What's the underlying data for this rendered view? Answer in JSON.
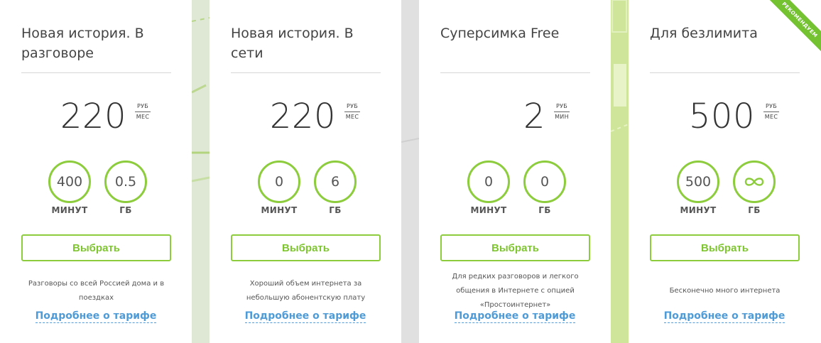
{
  "accent_color": "#8ccc3d",
  "link_color": "#4e9bd7",
  "tariffs": [
    {
      "title": "Новая история. В разговоре",
      "price": "220",
      "unit_top": "РУБ",
      "unit_bottom": "МЕС",
      "minutes": "400",
      "minutes_label": "МИНУТ",
      "gb": "0.5",
      "gb_label": "ГБ",
      "button": "Выбрать",
      "description": "Разговоры со всей Россией дома и в поездках",
      "link": "Подробнее о тарифе"
    },
    {
      "title": "Новая история. В сети",
      "price": "220",
      "unit_top": "РУБ",
      "unit_bottom": "МЕС",
      "minutes": "0",
      "minutes_label": "МИНУТ",
      "gb": "6",
      "gb_label": "ГБ",
      "button": "Выбрать",
      "description": "Хороший объем интернета за небольшую абонентскую плату",
      "link": "Подробнее о тарифе"
    },
    {
      "title": "Суперсимка Free",
      "price": "2",
      "unit_top": "РУБ",
      "unit_bottom": "МИН",
      "minutes": "0",
      "minutes_label": "МИНУТ",
      "gb": "0",
      "gb_label": "ГБ",
      "button": "Выбрать",
      "description": "Для редких разговоров и легкого общения в Интернете с опцией «Простоинтернет»",
      "link": "Подробнее о тарифе"
    },
    {
      "title": "Для безлимита",
      "price": "500",
      "unit_top": "РУБ",
      "unit_bottom": "МЕС",
      "minutes": "500",
      "minutes_label": "МИНУТ",
      "gb_icon": "infinity-icon",
      "gb_label": "ГБ",
      "button": "Выбрать",
      "description": "Бесконечно много интернета",
      "link": "Подробнее о тарифе",
      "badge": "РЕКОМЕНДУЕМ"
    }
  ]
}
